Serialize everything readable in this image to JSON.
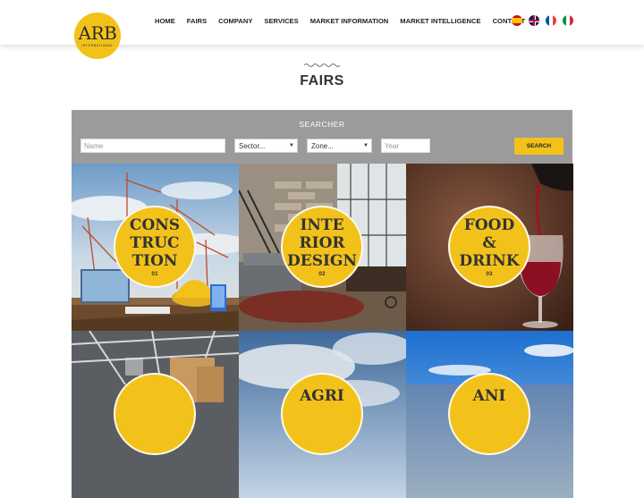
{
  "header": {
    "logo_text": "ARB",
    "logo_subtext": "INTERNATIONAL",
    "nav": [
      "HOME",
      "FAIRS",
      "COMPANY",
      "SERVICES",
      "MARKET INFORMATION",
      "MARKET INTELLIGENCE",
      "CONTACT"
    ],
    "languages": [
      "es",
      "en",
      "fr",
      "it"
    ]
  },
  "page_title": "FAIRS",
  "searcher": {
    "title": "SEARCHER",
    "name_placeholder": "Name",
    "sector_value": "Sector...",
    "zone_value": "Zone...",
    "year_placeholder": "Year",
    "search_label": "SEARCH"
  },
  "tiles": [
    {
      "lines": [
        "CONS",
        "TRUC",
        "TION"
      ],
      "num": "01"
    },
    {
      "lines": [
        "INTE",
        "RIOR",
        "DESIGN"
      ],
      "num": "02"
    },
    {
      "lines": [
        "FOOD",
        "&",
        "DRINK"
      ],
      "num": "03"
    },
    {
      "lines": [],
      "num": ""
    },
    {
      "lines": [
        "AGRI"
      ],
      "num": ""
    },
    {
      "lines": [
        "ANI"
      ],
      "num": ""
    }
  ],
  "colors": {
    "accent": "#f2c21b",
    "searcher_bg": "#9b9b9b"
  }
}
